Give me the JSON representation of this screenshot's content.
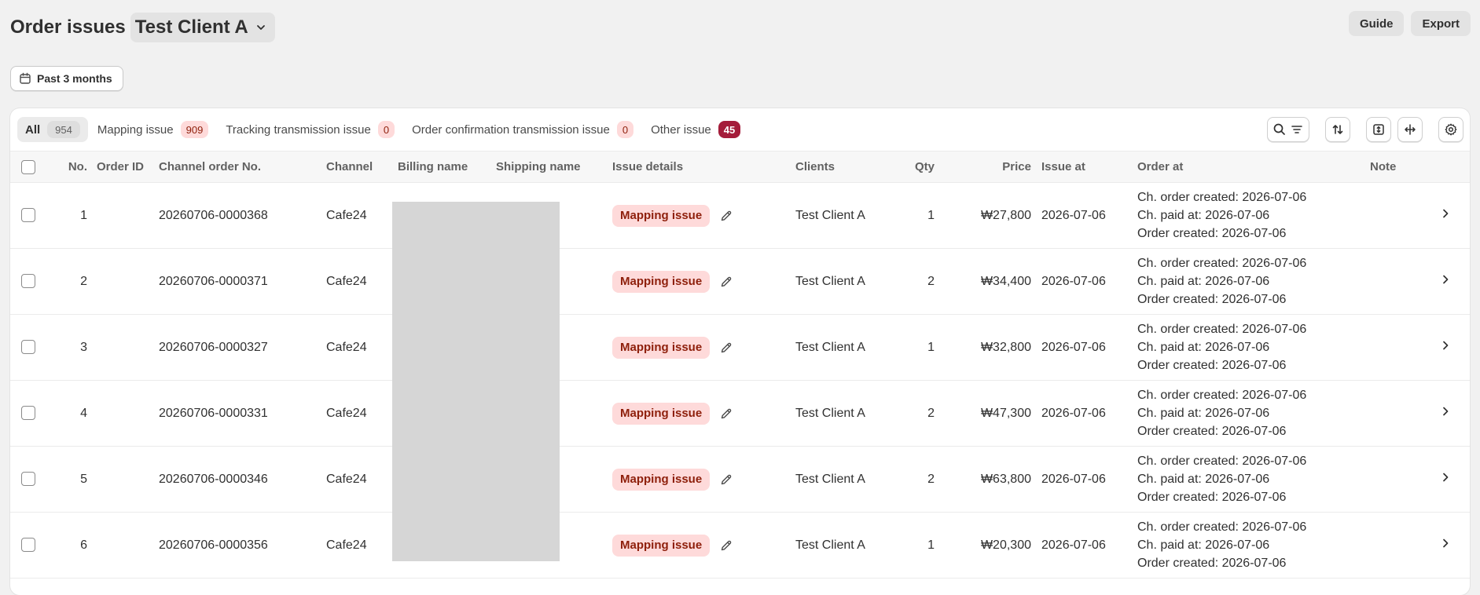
{
  "header": {
    "title": "Order issues",
    "client": "Test Client A",
    "actions": {
      "guide": "Guide",
      "export": "Export"
    }
  },
  "filters": {
    "date_range": "Past 3 months"
  },
  "tabs": [
    {
      "label": "All",
      "count": "954",
      "style": "neutral"
    },
    {
      "label": "Mapping issue",
      "count": "909",
      "style": "pink"
    },
    {
      "label": "Tracking transmission issue",
      "count": "0",
      "style": "pink"
    },
    {
      "label": "Order confirmation transmission issue",
      "count": "0",
      "style": "pink"
    },
    {
      "label": "Other issue",
      "count": "45",
      "style": "red"
    }
  ],
  "toolbar_icons": [
    "search-icon",
    "filter-icon",
    "sort-icon",
    "expand-vertical-icon",
    "expand-horizontal-icon",
    "gear-icon"
  ],
  "colors": {
    "issue_badge_bg": "#fedada",
    "issue_badge_text": "#8e1f0b",
    "other_badge_bg": "#a41c3a"
  },
  "table": {
    "columns": {
      "no": "No.",
      "order_id": "Order ID",
      "channel_order_no": "Channel order No.",
      "channel": "Channel",
      "billing_name": "Billing name",
      "shipping_name": "Shipping name",
      "issue_details": "Issue details",
      "clients": "Clients",
      "qty": "Qty",
      "price": "Price",
      "issue_at": "Issue at",
      "order_at": "Order at",
      "note": "Note"
    },
    "rows": [
      {
        "no": "1",
        "order_id": "",
        "channel_order_no": "20260706-0000368",
        "channel": "Cafe24",
        "billing_name": "",
        "shipping_name": "",
        "issue": "Mapping issue",
        "client": "Test Client A",
        "qty": "1",
        "price": "₩27,800",
        "issue_at": "2026-07-06",
        "ch_order_created": "Ch. order created: 2026-07-06",
        "ch_paid_at": "Ch. paid at: 2026-07-06",
        "order_created": "Order created: 2026-07-06",
        "note": ""
      },
      {
        "no": "2",
        "order_id": "",
        "channel_order_no": "20260706-0000371",
        "channel": "Cafe24",
        "billing_name": "",
        "shipping_name": "",
        "issue": "Mapping issue",
        "client": "Test Client A",
        "qty": "2",
        "price": "₩34,400",
        "issue_at": "2026-07-06",
        "ch_order_created": "Ch. order created: 2026-07-06",
        "ch_paid_at": "Ch. paid at: 2026-07-06",
        "order_created": "Order created: 2026-07-06",
        "note": ""
      },
      {
        "no": "3",
        "order_id": "",
        "channel_order_no": "20260706-0000327",
        "channel": "Cafe24",
        "billing_name": "",
        "shipping_name": "",
        "issue": "Mapping issue",
        "client": "Test Client A",
        "qty": "1",
        "price": "₩32,800",
        "issue_at": "2026-07-06",
        "ch_order_created": "Ch. order created: 2026-07-06",
        "ch_paid_at": "Ch. paid at: 2026-07-06",
        "order_created": "Order created: 2026-07-06",
        "note": ""
      },
      {
        "no": "4",
        "order_id": "",
        "channel_order_no": "20260706-0000331",
        "channel": "Cafe24",
        "billing_name": "",
        "shipping_name": "",
        "issue": "Mapping issue",
        "client": "Test Client A",
        "qty": "2",
        "price": "₩47,300",
        "issue_at": "2026-07-06",
        "ch_order_created": "Ch. order created: 2026-07-06",
        "ch_paid_at": "Ch. paid at: 2026-07-06",
        "order_created": "Order created: 2026-07-06",
        "note": ""
      },
      {
        "no": "5",
        "order_id": "",
        "channel_order_no": "20260706-0000346",
        "channel": "Cafe24",
        "billing_name": "",
        "shipping_name": "",
        "issue": "Mapping issue",
        "client": "Test Client A",
        "qty": "2",
        "price": "₩63,800",
        "issue_at": "2026-07-06",
        "ch_order_created": "Ch. order created: 2026-07-06",
        "ch_paid_at": "Ch. paid at: 2026-07-06",
        "order_created": "Order created: 2026-07-06",
        "note": ""
      },
      {
        "no": "6",
        "order_id": "",
        "channel_order_no": "20260706-0000356",
        "channel": "Cafe24",
        "billing_name": "",
        "shipping_name": "",
        "issue": "Mapping issue",
        "client": "Test Client A",
        "qty": "1",
        "price": "₩20,300",
        "issue_at": "2026-07-06",
        "ch_order_created": "Ch. order created: 2026-07-06",
        "ch_paid_at": "Ch. paid at: 2026-07-06",
        "order_created": "Order created: 2026-07-06",
        "note": ""
      }
    ]
  }
}
